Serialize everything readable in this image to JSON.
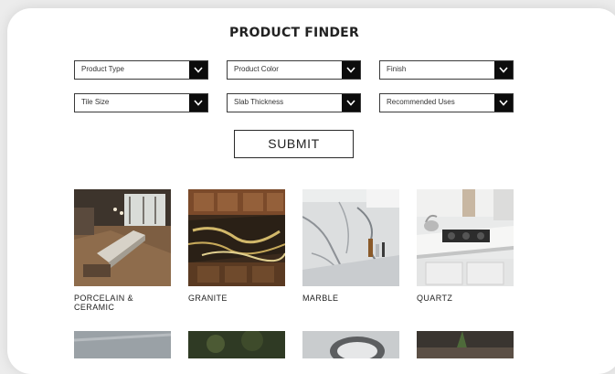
{
  "finder": {
    "title": "PRODUCT FINDER",
    "filters": [
      {
        "label": "Product Type"
      },
      {
        "label": "Product Color"
      },
      {
        "label": "Finish"
      },
      {
        "label": "Tile Size"
      },
      {
        "label": "Slab Thickness"
      },
      {
        "label": "Recommended Uses"
      }
    ],
    "submit_label": "SUBMIT"
  },
  "categories": [
    {
      "label": "PORCELAIN & CERAMIC"
    },
    {
      "label": "GRANITE"
    },
    {
      "label": "MARBLE"
    },
    {
      "label": "QUARTZ"
    }
  ],
  "colors": {
    "dropdown_arrow_bg": "#0c0c0c",
    "border": "#3a3a3a",
    "text": "#222222"
  }
}
